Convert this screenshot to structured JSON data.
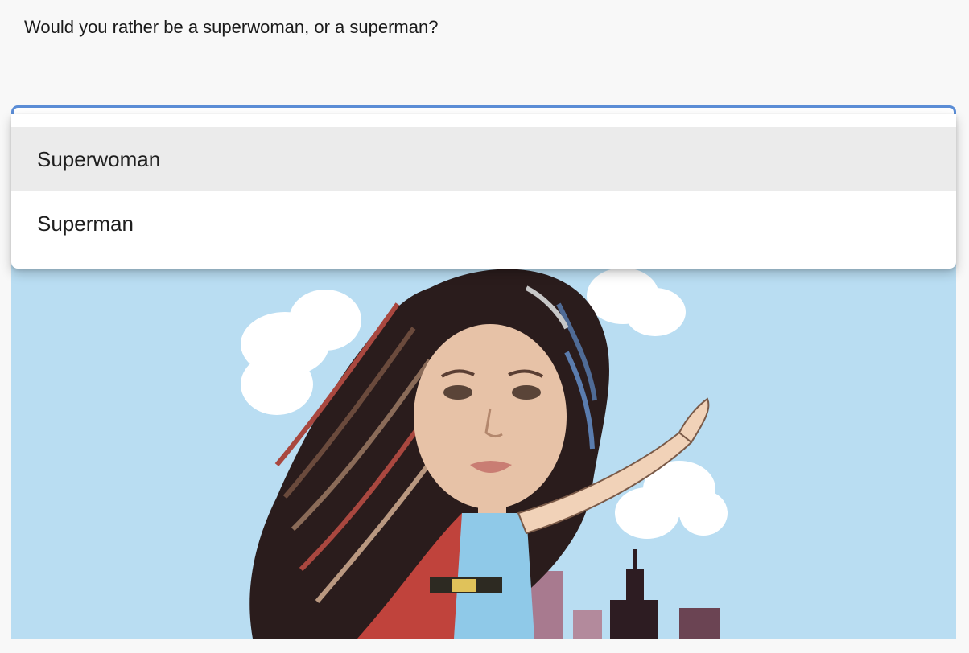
{
  "question": {
    "text": "Would you rather be a superwoman, or a superman?"
  },
  "select": {
    "options": [
      {
        "label": "Superwoman",
        "highlighted": true
      },
      {
        "label": "Superman",
        "highlighted": false
      }
    ]
  },
  "colors": {
    "accent": "#5b8dd6",
    "option_highlight": "#ebebeb",
    "image_sky": "#b9ddf2"
  },
  "image": {
    "subject": "cartoon-superwoman-illustration"
  }
}
